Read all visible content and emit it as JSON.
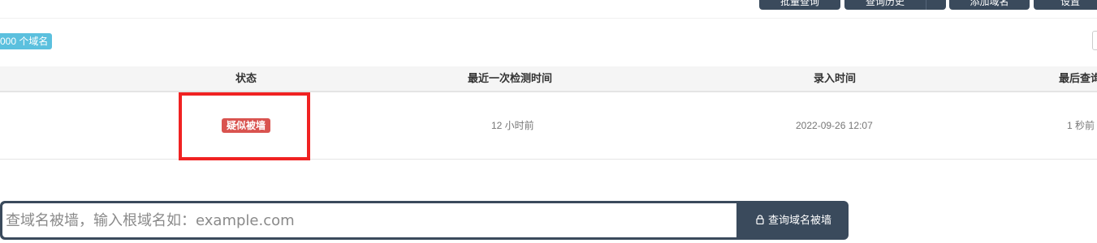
{
  "toolbar": {
    "buttons": [
      "批量查询",
      "查询历史",
      "添加域名",
      "设置"
    ]
  },
  "summary": {
    "count_badge": "000 个域名"
  },
  "table": {
    "columns": [
      "状态",
      "最近一次检测时间",
      "录入时间",
      "最后查询"
    ],
    "rows": [
      {
        "status": "疑似被墙",
        "last_check": "12 小时前",
        "created": "2022-09-26 12:07",
        "last_query": "1 秒前"
      }
    ]
  },
  "search": {
    "placeholder": "查域名被墙，输入根域名如：example.com",
    "button_label": "查询域名被墙"
  },
  "colors": {
    "accent": "#3a4a5c",
    "badge_info": "#5bc0de",
    "status_danger": "#d9534f",
    "highlight": "#f02222"
  }
}
